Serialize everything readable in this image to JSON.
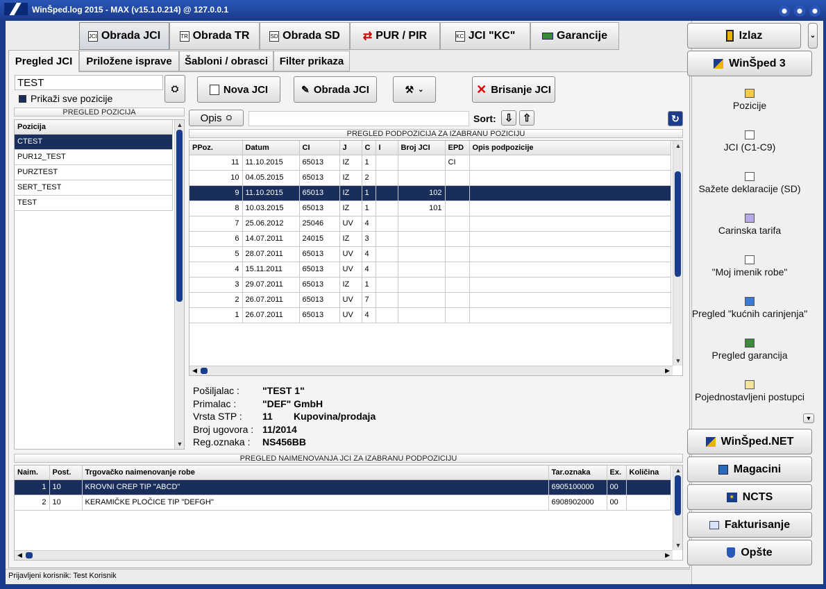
{
  "window": {
    "title": "WinŠped.log 2015 - MAX (v15.1.0.214) @ 127.0.0.1"
  },
  "main_tabs": [
    {
      "label": "Obrada JCI",
      "icon": "document-icon"
    },
    {
      "label": "Obrada TR",
      "icon": "document-icon"
    },
    {
      "label": "Obrada SD",
      "icon": "document-icon"
    },
    {
      "label": "PUR / PIR",
      "icon": "arrows-icon"
    },
    {
      "label": "JCI \"KC\"",
      "icon": "document-icon"
    },
    {
      "label": "Garancije",
      "icon": "money-icon"
    }
  ],
  "sub_tabs": [
    "Pregled JCI",
    "Priložene isprave",
    "Šabloni / obrasci",
    "Filter prikaza"
  ],
  "left": {
    "filter_value": "TEST",
    "show_all_label": "Prikaži sve pozicije",
    "section_title": "PREGLED POZICIJA",
    "column": "Pozicija",
    "items": [
      "CTEST",
      "PUR12_TEST",
      "PURZTEST",
      "SERT_TEST",
      "TEST"
    ],
    "selected": 0
  },
  "toolbar": {
    "new_label": "Nova JCI",
    "process_label": "Obrada JCI",
    "delete_label": "Brisanje JCI",
    "opis_label": "Opis",
    "sort_label": "Sort:"
  },
  "sub": {
    "section_title": "PREGLED PODPOZICIJA ZA IZABRANU POZICIJU",
    "columns": [
      "PPoz.",
      "Datum",
      "CI",
      "J",
      "C",
      "I",
      "Broj JCI",
      "EPD",
      "Opis podpozicije"
    ],
    "rows": [
      [
        "11",
        "11.10.2015",
        "65013",
        "IZ",
        "1",
        "",
        "",
        "CI",
        ""
      ],
      [
        "10",
        "04.05.2015",
        "65013",
        "IZ",
        "2",
        "",
        "",
        "",
        ""
      ],
      [
        "9",
        "11.10.2015",
        "65013",
        "IZ",
        "1",
        "",
        "102",
        "",
        ""
      ],
      [
        "8",
        "10.03.2015",
        "65013",
        "IZ",
        "1",
        "",
        "101",
        "",
        ""
      ],
      [
        "7",
        "25.06.2012",
        "25046",
        "UV",
        "4",
        "",
        "",
        "",
        ""
      ],
      [
        "6",
        "14.07.2011",
        "24015",
        "IZ",
        "3",
        "",
        "",
        "",
        ""
      ],
      [
        "5",
        "28.07.2011",
        "65013",
        "UV",
        "4",
        "",
        "",
        "",
        ""
      ],
      [
        "4",
        "15.11.2011",
        "65013",
        "UV",
        "4",
        "",
        "",
        "",
        ""
      ],
      [
        "3",
        "29.07.2011",
        "65013",
        "IZ",
        "1",
        "",
        "",
        "",
        ""
      ],
      [
        "2",
        "26.07.2011",
        "65013",
        "UV",
        "7",
        "",
        "",
        "",
        ""
      ],
      [
        "1",
        "26.07.2011",
        "65013",
        "UV",
        "4",
        "",
        "",
        "",
        ""
      ]
    ],
    "selected": 2
  },
  "detail": [
    {
      "label": "Pošiljalac :",
      "value": "\"TEST 1\"",
      "extra": ""
    },
    {
      "label": "Primalac :",
      "value": "\"DEF\" GmbH",
      "extra": ""
    },
    {
      "label": "Vrsta STP :",
      "value": "11",
      "extra": "Kupovina/prodaja"
    },
    {
      "label": "Broj ugovora :",
      "value": "11/2014",
      "extra": ""
    },
    {
      "label": "Reg.oznaka :",
      "value": "NS456BB",
      "extra": ""
    }
  ],
  "items": {
    "section_title": "PREGLED NAIMENOVANJA JCI ZA IZABRANU PODPOZICIJU",
    "columns": [
      "Naim.",
      "Post.",
      "Trgovačko naimenovanje robe",
      "Tar.oznaka",
      "Ex.",
      "Količina"
    ],
    "rows": [
      [
        "1",
        "10",
        "KROVNI CREP TIP \"ABCD\"",
        "6905100000",
        "00",
        ""
      ],
      [
        "2",
        "10",
        "KERAMIČKE PLOČICE TIP \"DEFGH\"",
        "6908902000",
        "00",
        ""
      ]
    ],
    "selected": 0
  },
  "right": {
    "exit_label": "Izlaz",
    "winsped_label": "WinŠped 3",
    "menu": [
      "Pozicije",
      "JCI (C1-C9)",
      "Sažete deklaracije (SD)",
      "Carinska tarifa",
      "\"Moj imenik robe\"",
      "Pregled \"kućnih carinjenja\"",
      "Pregled garancija",
      "Pojednostavljeni postupci"
    ],
    "bottom": [
      "WinŠped.NET",
      "Magacini",
      "NCTS",
      "Fakturisanje",
      "Opšte"
    ]
  },
  "status": {
    "text": "Prijavljeni korisnik: Test Korisnik"
  }
}
